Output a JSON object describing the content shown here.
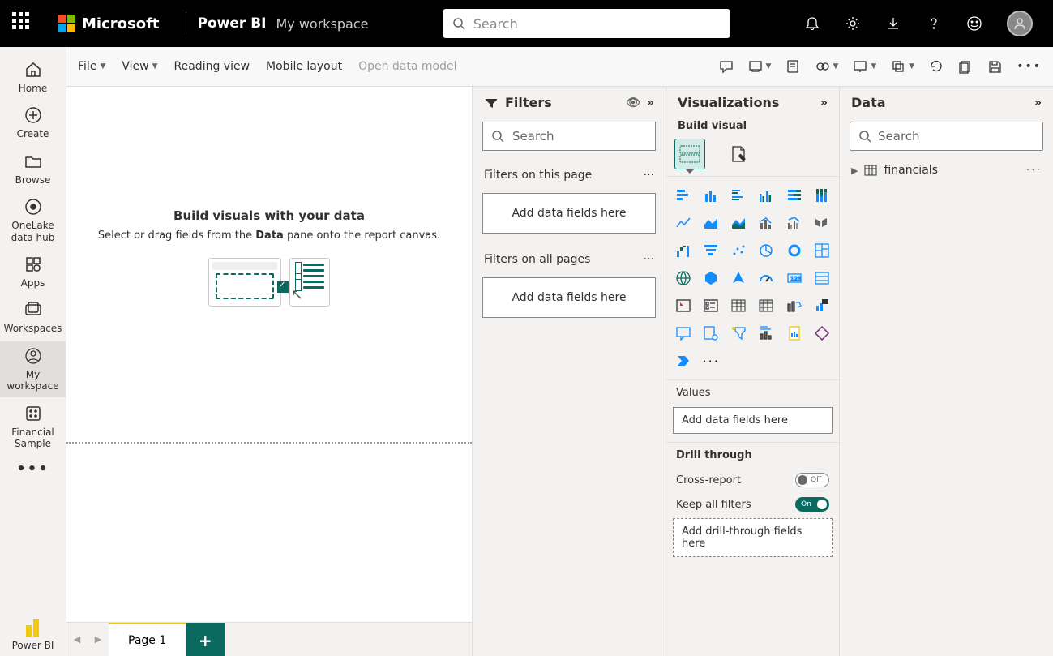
{
  "topbar": {
    "brand_ms": "Microsoft",
    "brand_pbi": "Power BI",
    "workspace": "My workspace",
    "search_placeholder": "Search"
  },
  "leftnav": {
    "home": "Home",
    "create": "Create",
    "browse": "Browse",
    "onelake": "OneLake data hub",
    "apps": "Apps",
    "workspaces": "Workspaces",
    "myws": "My workspace",
    "sample": "Financial Sample",
    "pbi": "Power BI"
  },
  "ribbon": {
    "file": "File",
    "view": "View",
    "reading": "Reading view",
    "mobile": "Mobile layout",
    "opendata": "Open data model"
  },
  "canvas": {
    "title": "Build visuals with your data",
    "sub_pre": "Select or drag fields from the ",
    "sub_bold": "Data",
    "sub_post": " pane onto the report canvas."
  },
  "tabs": {
    "page1": "Page 1"
  },
  "filters": {
    "title": "Filters",
    "search": "Search",
    "on_page": "Filters on this page",
    "on_all": "Filters on all pages",
    "add": "Add data fields here"
  },
  "viz": {
    "title": "Visualizations",
    "build": "Build visual",
    "values": "Values",
    "add": "Add data fields here",
    "drill": "Drill through",
    "cross": "Cross-report",
    "keep": "Keep all filters",
    "off": "Off",
    "on": "On",
    "adddrill": "Add drill-through fields here"
  },
  "data": {
    "title": "Data",
    "search": "Search",
    "table": "financials"
  }
}
